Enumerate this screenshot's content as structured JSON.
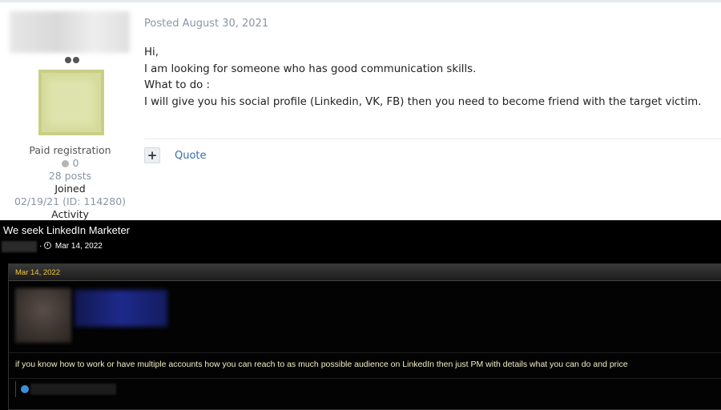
{
  "top_post": {
    "author": {
      "group": "Paid registration",
      "reputation": "0",
      "posts": "28 posts",
      "joined_label": "Joined",
      "joined_value": "02/19/21 (ID: 114280)",
      "activity_label": "Activity"
    },
    "posted": "Posted August 30, 2021",
    "body_lines": [
      "Hi,",
      "I am looking for someone who has good communication skills.",
      "What to do :",
      "I will give you his social profile (Linkedin, VK, FB) then you need to become friend with the target victim."
    ],
    "actions": {
      "plus_label": "+",
      "quote_label": "Quote"
    }
  },
  "bottom_post": {
    "thread_title": "We seek LinkedIn Marketer",
    "thread_date": "Mar 14, 2022",
    "post_date": "Mar 14, 2022",
    "message": "if you know how to work or have multiple accounts how you can reach to as much possible audience on LinkedIn then just PM with details what you can do and price"
  },
  "colors": {
    "muted_blue_gray": "#8a95a6",
    "link_blue": "#3a6ea5",
    "dark_bg": "#000000",
    "gold": "#f0c73a",
    "message_text": "#f3efc0"
  }
}
